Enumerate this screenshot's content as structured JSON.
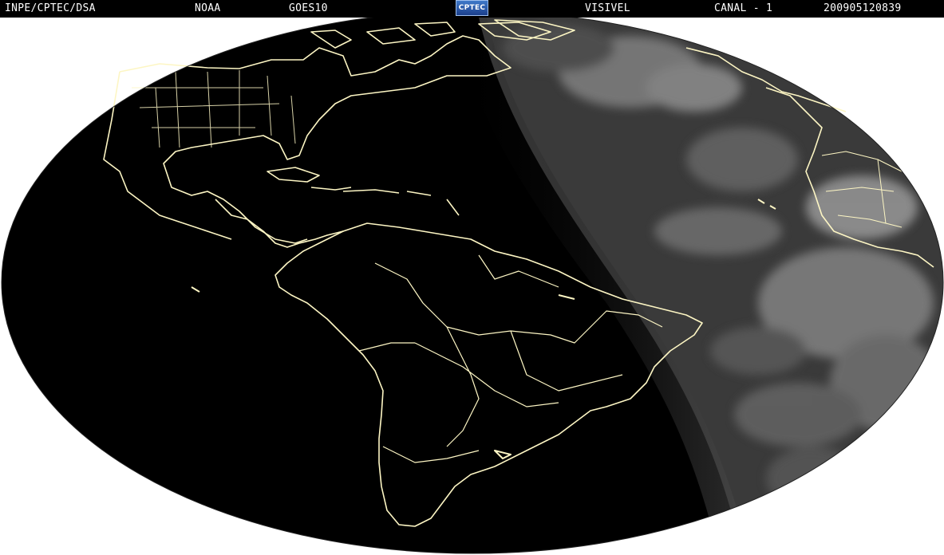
{
  "header": {
    "source": "INPE/CPTEC/DSA",
    "agency": "NOAA",
    "satellite": "GOES10",
    "logo_text": "CPTEC",
    "product": "VISIVEL",
    "channel": "CANAL - 1",
    "timestamp": "200905120839"
  },
  "map": {
    "background_color": "#ffffff",
    "night_color": "#000000",
    "day_color": "#3a3a3a",
    "coastline_color": "#fdf6c4",
    "terminator": "day side east of approximately longitude 20W over the Atlantic"
  }
}
